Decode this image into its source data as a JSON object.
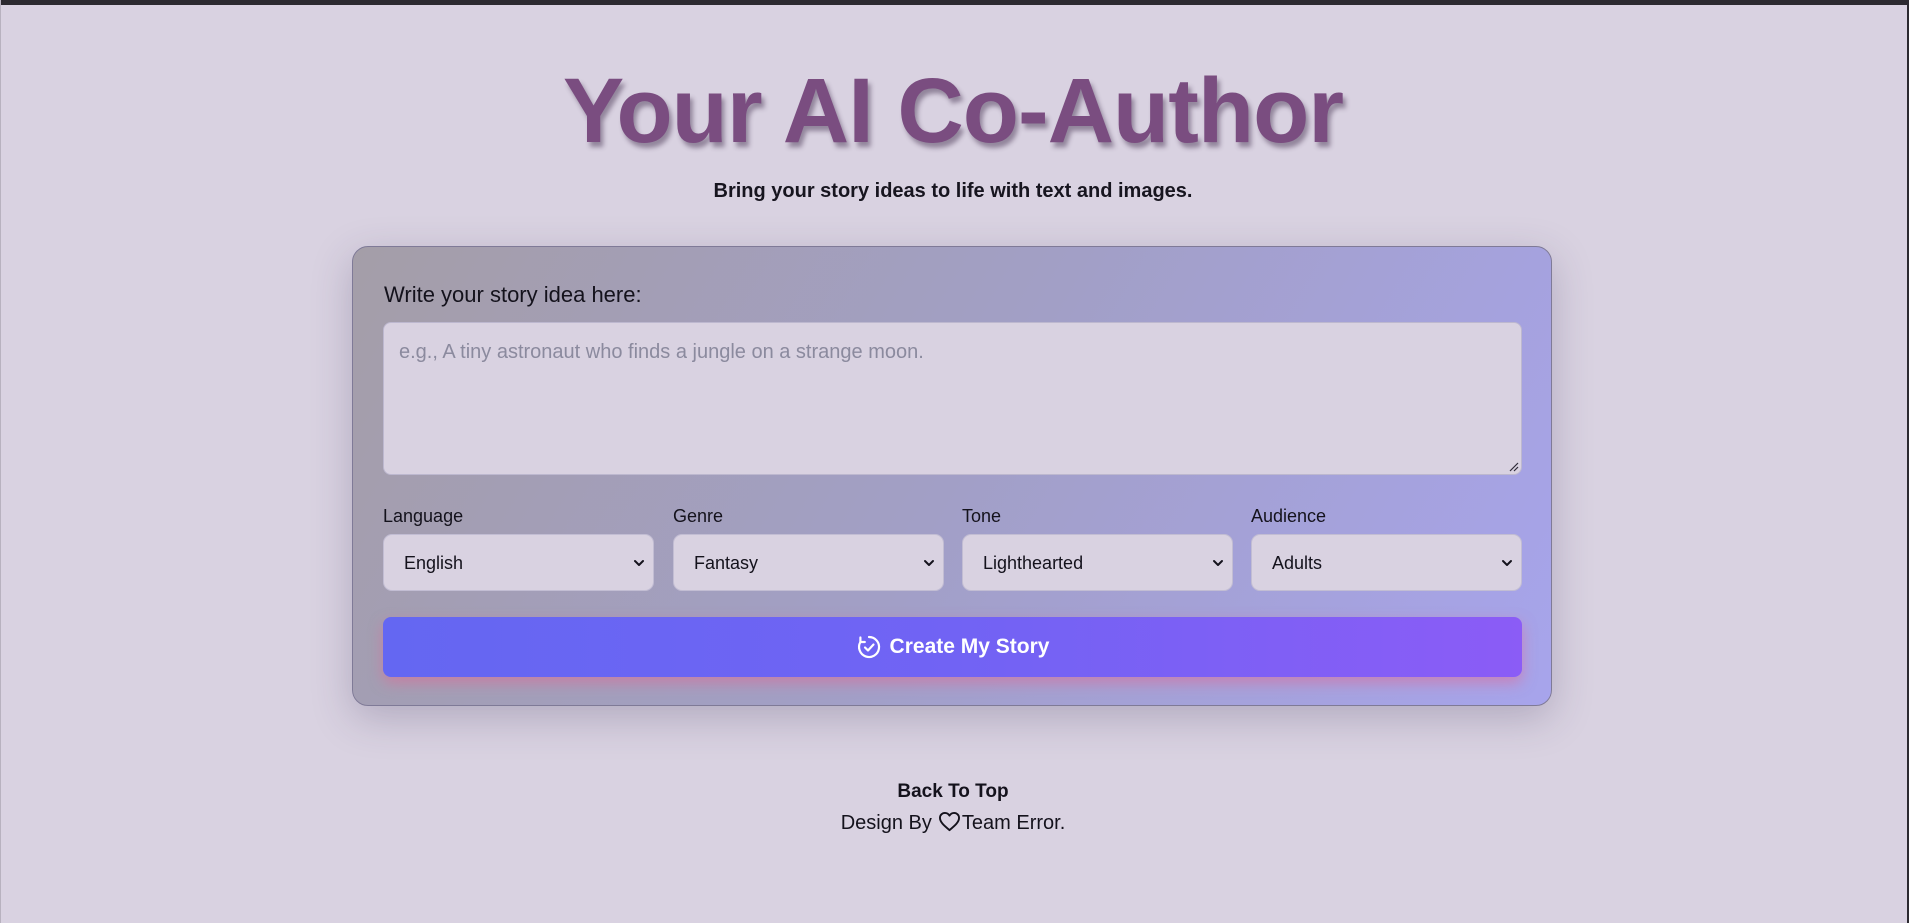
{
  "hero": {
    "title": "Your AI Co-Author",
    "subtitle": "Bring your story ideas to life with text and images."
  },
  "form": {
    "prompt_label": "Write your story idea here:",
    "prompt_placeholder": "e.g., A tiny astronaut who finds a jungle on a strange moon.",
    "prompt_value": "",
    "fields": [
      {
        "label": "Language",
        "value": "English"
      },
      {
        "label": "Genre",
        "value": "Fantasy"
      },
      {
        "label": "Tone",
        "value": "Lighthearted"
      },
      {
        "label": "Audience",
        "value": "Adults"
      }
    ],
    "submit_label": "Create My Story",
    "submit_icon": "magic-check-icon"
  },
  "footer": {
    "back_to_top": "Back To Top",
    "credit_prefix": "Design By",
    "credit_icon": "heart-icon",
    "credit_suffix": "Team Error."
  },
  "colors": {
    "background": "#d9d2e1",
    "title": "#7a4d80",
    "button_start": "#6467f2",
    "button_end": "#8b5cf6",
    "button_glow": "#e26896"
  }
}
